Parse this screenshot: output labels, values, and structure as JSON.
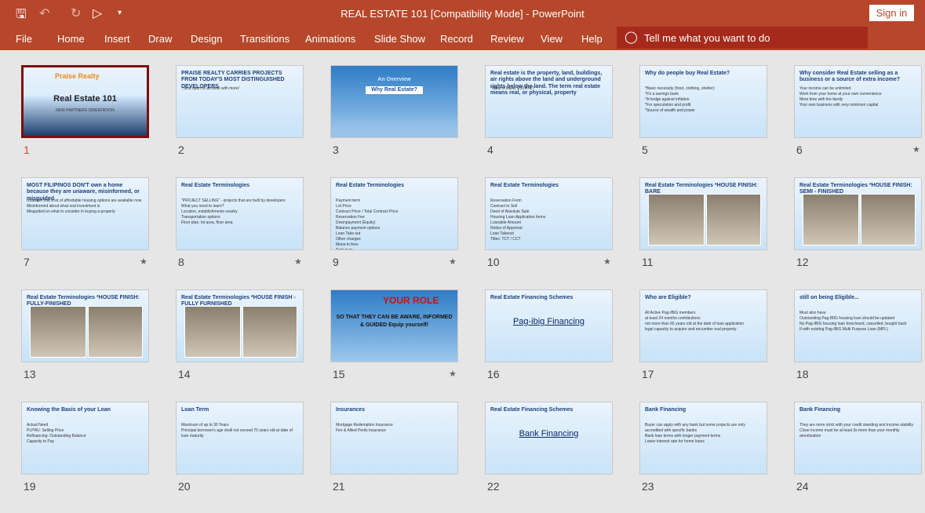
{
  "window": {
    "title": "REAL ESTATE 101 [Compatibility Mode]  -  PowerPoint",
    "sign_in": "Sign in"
  },
  "qat": [
    "save-icon",
    "undo-icon",
    "redo-icon",
    "start-from-beginning-icon",
    "customize-icon"
  ],
  "ribbon": {
    "tabs": [
      "File",
      "Home",
      "Insert",
      "Draw",
      "Design",
      "Transitions",
      "Animations",
      "Slide Show",
      "Record",
      "Review",
      "View",
      "Help"
    ],
    "tell_me": "Tell me what you want to do"
  },
  "colors": {
    "accent": "#b7472a",
    "selected": "#7a1010"
  },
  "slides": [
    {
      "n": "1",
      "title": "Real Estate 101",
      "body": "NEW PARTNERS ORIENTATION",
      "logo": "Praise Realty Marketing Corporation",
      "star": false,
      "selected": true
    },
    {
      "n": "2",
      "title": "PRAISE REALTY CARRIES PROJECTS FROM TODAY'S MOST DISTINGUISHED DEVELOPERS",
      "body": "...and open to accredit with more!",
      "star": false
    },
    {
      "n": "3",
      "title": "An Overview",
      "body": "Why Real Estate?",
      "star": false
    },
    {
      "n": "4",
      "title": "Real estate is the property, land, buildings, air rights above the land and underground rights below the land. The term real estate means real, or physical, property",
      "body": "*What is REAL ESTATE?",
      "star": false
    },
    {
      "n": "5",
      "title": "Why do people buy Real Estate?",
      "body": "*Basic necessity (food, clothing, shelter)\n*It's a savings bank\n*A hedge against inflation\n*For speculation and profit\n*Source of wealth and power",
      "star": false
    },
    {
      "n": "6",
      "title": "Why consider Real Estate selling as a business or a source of extra income?",
      "body": "Your income can be unlimited\nWork from your home at your own convenience\nMore time with the family\nYour own business with very minimum capital",
      "star": true
    },
    {
      "n": "7",
      "title": "MOST FILIPINOS DON'T own a home because they are unaware, misinformed, or misguided",
      "body": "Unaware that a lot of affordable housing options are available now\nMisinformed about what real investment is\nMisguided on what to consider in buying a property",
      "star": true
    },
    {
      "n": "8",
      "title": "Real Estate Terminologies",
      "body": "\"PROJECT SELLING\" - projects that are built by developers\nWhat you need to learn?\nLocation, establishments nearby\nTransportation options\nFloor plan, lot area, floor area",
      "star": true
    },
    {
      "n": "9",
      "title": "Real Estate Terminologies",
      "body": "Payment term\nLot Price\nContract Price / Total Contract Price\nReservation Fee\nDownpayment (Equity)\nBalance payment options\nLoan Take out\nOther charges\nMove-in fees\nTurn over",
      "star": true
    },
    {
      "n": "10",
      "title": "Real Estate Terminologies",
      "body": "Reservation Form\nContract to Sell\nDeed of Absolute Sale\nHousing Loan Application forms\nLoanable Amount\nNotice of Approval\nLoan Takeout\nTitles: TCT / CCT",
      "star": true
    },
    {
      "n": "11",
      "title": "Real Estate Terminologies *HOUSE FINISH: BARE",
      "body": "",
      "photos": true,
      "star": false
    },
    {
      "n": "12",
      "title": "Real Estate Terminologies *HOUSE FINISH: SEMI - FINISHED",
      "body": "",
      "photos": true,
      "star": false
    },
    {
      "n": "13",
      "title": "Real Estate Terminologies *HOUSE FINISH: FULLY-FINISHED",
      "body": "",
      "photos": true,
      "star": false
    },
    {
      "n": "14",
      "title": "Real Estate Terminologies *HOUSE FINISH - FULLY FURNISHED",
      "body": "",
      "photos": true,
      "star": false
    },
    {
      "n": "15",
      "title": "YOUR ROLE",
      "body": "SO THAT THEY CAN BE AWARE, INFORMED & GUIDED Equip yourself!",
      "star": true
    },
    {
      "n": "16",
      "title": "Real Estate Financing Schemes",
      "big": "Pag-ibig Financing",
      "star": false
    },
    {
      "n": "17",
      "title": "Who are Eligible?",
      "body": "All Active Pag-IBIG members\nat least 24 months contributions\nnot more than 65 years old at the date of loan application\nlegal capacity to acquire and encumber real property",
      "star": false
    },
    {
      "n": "18",
      "title": "still on being Eligible...",
      "body": "Must also have\nOutstanding Pag-IBIG housing loan should be updated\nNo Pag-IBIG housing loan foreclosed, cancelled, bought back\nIf with existing Pag-IBIG Multi Purpose Loan (MPL)",
      "star": false
    },
    {
      "n": "19",
      "title": "Knowing the Basis of your Loan",
      "body": "Actual Need\nPLPRU: Selling Price\nRefinancing: Outstanding Balance\nCapacity to Pay",
      "star": false
    },
    {
      "n": "20",
      "title": "Loan Term",
      "body": "Maximum of up to 30 Years\nPrincipal borrower's age shall not exceed 70 years old at date of loan maturity",
      "star": false
    },
    {
      "n": "21",
      "title": "Insurances",
      "body": "Mortgage Redemption Insurance\nFire & Allied Perils Insurance",
      "star": false
    },
    {
      "n": "22",
      "title": "Real Estate Financing Schemes",
      "big": "Bank Financing",
      "star": false
    },
    {
      "n": "23",
      "title": "Bank Financing",
      "body": "Buyer can apply with any bank but some projects are only accredited with specific banks\nBank loan terms with longer payment terms\nLower interest rate for home loans",
      "star": false
    },
    {
      "n": "24",
      "title": "Bank Financing",
      "body": "They are more strict with your credit standing and income stability\nClose income must be at least 3x more than your monthly amortization",
      "star": false
    }
  ]
}
